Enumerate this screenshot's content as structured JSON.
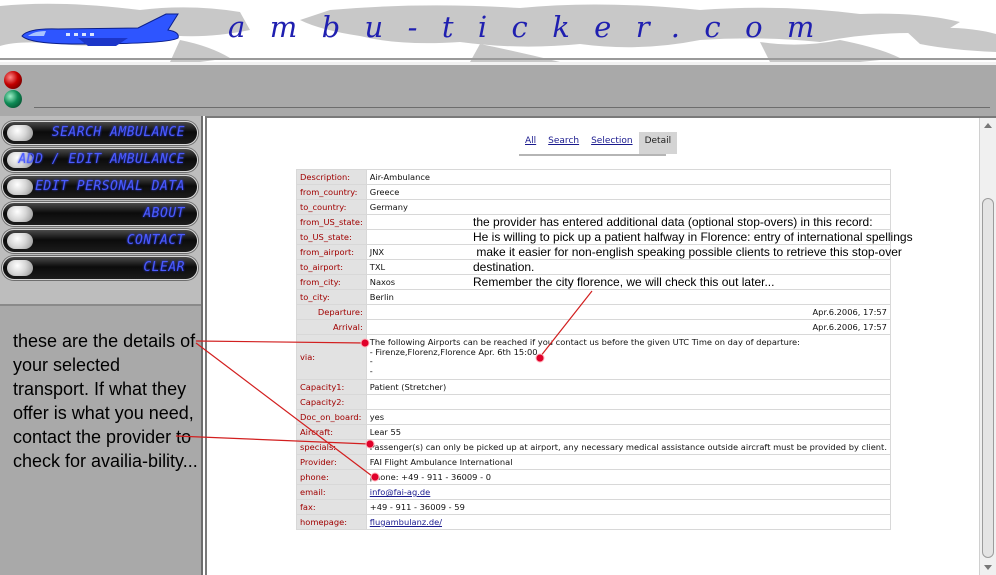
{
  "header": {
    "site_title": "ambu-ticker.com",
    "logo_icon": "airplane-icon"
  },
  "toolbar": {
    "status_lights": [
      "red-light-icon",
      "green-light-icon"
    ]
  },
  "sidebar": {
    "nav": [
      {
        "label": "SEARCH AMBULANCE"
      },
      {
        "label": "ADD / EDIT AMBULANCE"
      },
      {
        "label": "EDIT PERSONAL DATA"
      },
      {
        "label": "ABOUT"
      },
      {
        "label": "CONTACT"
      },
      {
        "label": "CLEAR"
      }
    ],
    "help_text": "these are the details of your selected transport. If what they offer is what you need, contact the provider to check for availia-bility..."
  },
  "tabs": [
    {
      "label": "All",
      "active": false
    },
    {
      "label": "Search",
      "active": false
    },
    {
      "label": "Selection",
      "active": false
    },
    {
      "label": "Detail",
      "active": true
    }
  ],
  "detail": {
    "description": {
      "label": "Description:",
      "value": "Air-Ambulance"
    },
    "from_country": {
      "label": "from_country:",
      "value": "Greece"
    },
    "to_country": {
      "label": "to_country:",
      "value": "Germany"
    },
    "from_us_state": {
      "label": "from_US_state:",
      "value": ""
    },
    "to_us_state": {
      "label": "to_US_state:",
      "value": ""
    },
    "from_airport": {
      "label": "from_airport:",
      "value": "JNX"
    },
    "to_airport": {
      "label": "to_airport:",
      "value": "TXL"
    },
    "from_city": {
      "label": "from_city:",
      "value": "Naxos"
    },
    "to_city": {
      "label": "to_city:",
      "value": "Berlin"
    },
    "departure": {
      "label": "Departure:",
      "value": "Apr.6.2006, 17:57"
    },
    "arrival": {
      "label": "Arrival:",
      "value": "Apr.6.2006, 17:57"
    },
    "via": {
      "label": "via:",
      "lines": [
        "The following Airports can be reached if you contact us before the given UTC Time on day of departure:",
        "- Firenze,Florenz,Florence Apr. 6th 15:00",
        "-",
        "-"
      ]
    },
    "capacity1": {
      "label": "Capacity1:",
      "value": "Patient (Stretcher)"
    },
    "capacity2": {
      "label": "Capacity2:",
      "value": ""
    },
    "doc_on_board": {
      "label": "Doc_on_board:",
      "value": "yes"
    },
    "aircraft": {
      "label": "Aircraft:",
      "value": "Lear 55"
    },
    "specials": {
      "label": "specials:",
      "value": "Passenger(s) can only be picked up at airport, any necessary medical assistance outside aircraft must be provided by client."
    },
    "provider": {
      "label": "Provider:",
      "value": "FAI Flight Ambulance International"
    },
    "phone": {
      "label": "phone:",
      "value": "phone: +49 - 911 - 36009 - 0"
    },
    "email": {
      "label": "email:",
      "value": "info@fai-ag.de"
    },
    "fax": {
      "label": "fax:",
      "value": "+49 - 911 - 36009 - 59"
    },
    "homepage": {
      "label": "homepage:",
      "value": "flugambulanz.de/"
    }
  },
  "annotation": {
    "lines": [
      "the provider has entered additional data (optional stop-overs) in this record:",
      "He is willing to pick up a patient halfway in Florence: entry of international spellings",
      " make it easier for non-english speaking possible clients to retrieve this stop-over",
      "destination.",
      "Remember the city florence, we will check this out later..."
    ]
  },
  "colors": {
    "accent_red": "#e0002a",
    "nav_text": "#4b5cff",
    "title_blue": "#1f1fb0",
    "panel_gray": "#a9a9a9"
  }
}
